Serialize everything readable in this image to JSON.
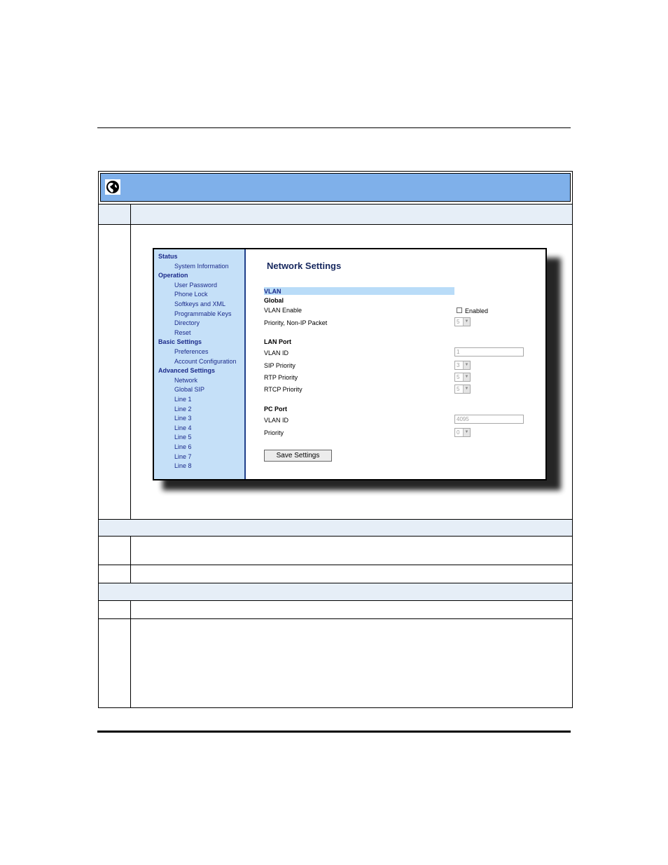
{
  "screenshot": {
    "nav": [
      {
        "label": "Status",
        "kind": "head"
      },
      {
        "label": "System Information",
        "kind": "link"
      },
      {
        "label": "Operation",
        "kind": "head"
      },
      {
        "label": "User Password",
        "kind": "link"
      },
      {
        "label": "Phone Lock",
        "kind": "link"
      },
      {
        "label": "Softkeys and XML",
        "kind": "link"
      },
      {
        "label": "Programmable Keys",
        "kind": "link"
      },
      {
        "label": "Directory",
        "kind": "link"
      },
      {
        "label": "Reset",
        "kind": "link"
      },
      {
        "label": "Basic Settings",
        "kind": "head"
      },
      {
        "label": "Preferences",
        "kind": "link"
      },
      {
        "label": "Account Configuration",
        "kind": "link"
      },
      {
        "label": "Advanced Settings",
        "kind": "head"
      },
      {
        "label": "Network",
        "kind": "link"
      },
      {
        "label": "Global SIP",
        "kind": "link"
      },
      {
        "label": "Line 1",
        "kind": "link"
      },
      {
        "label": "Line 2",
        "kind": "link"
      },
      {
        "label": "Line 3",
        "kind": "link"
      },
      {
        "label": "Line 4",
        "kind": "link"
      },
      {
        "label": "Line 5",
        "kind": "link"
      },
      {
        "label": "Line 6",
        "kind": "link"
      },
      {
        "label": "Line 7",
        "kind": "link"
      },
      {
        "label": "Line 8",
        "kind": "link"
      }
    ],
    "title": "Network Settings",
    "vlan_heading": "VLAN",
    "global_heading": "Global",
    "vlan_enable_label": "VLAN Enable",
    "enabled_label": "Enabled",
    "priority_non_ip_label": "Priority, Non-IP Packet",
    "priority_non_ip_value": "5",
    "lan_port_heading": "LAN Port",
    "lan_vlan_id_label": "VLAN ID",
    "lan_vlan_id_value": "1",
    "sip_priority_label": "SIP Priority",
    "sip_priority_value": "3",
    "rtp_priority_label": "RTP Priority",
    "rtp_priority_value": "5",
    "rtcp_priority_label": "RTCP Priority",
    "rtcp_priority_value": "5",
    "pc_port_heading": "PC Port",
    "pc_vlan_id_label": "VLAN ID",
    "pc_vlan_id_value": "4095",
    "pc_priority_label": "Priority",
    "pc_priority_value": "0",
    "save_button": "Save Settings"
  }
}
